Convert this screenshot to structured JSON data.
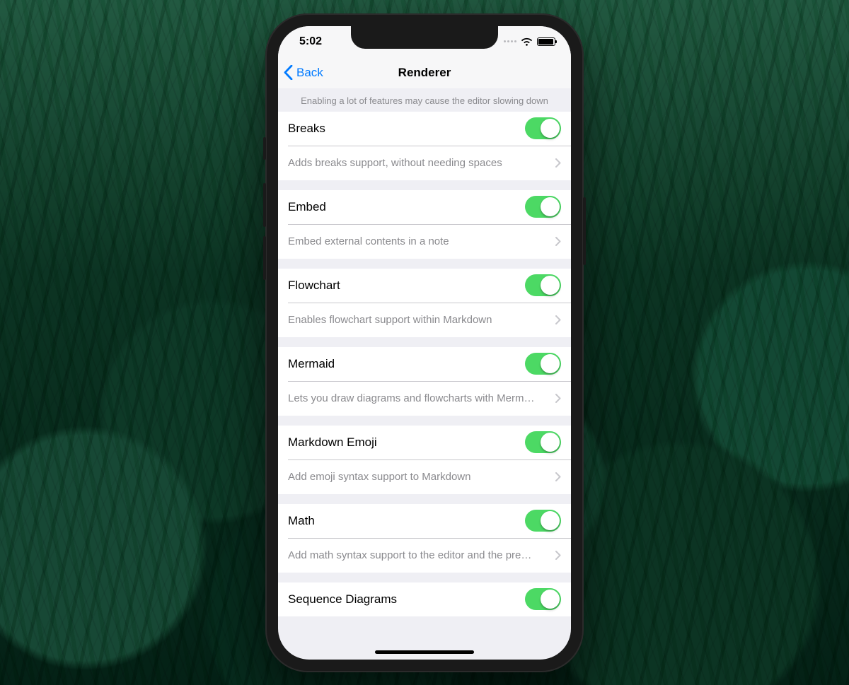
{
  "status": {
    "time": "5:02"
  },
  "nav": {
    "back": "Back",
    "title": "Renderer"
  },
  "hint": "Enabling a lot of features may cause the editor slowing down",
  "colors": {
    "accent": "#007aff",
    "switch_on": "#4cd964"
  },
  "rows": [
    {
      "label": "Breaks",
      "on": true,
      "desc": "Adds breaks support, without needing spaces"
    },
    {
      "label": "Embed",
      "on": true,
      "desc": "Embed external contents in a note"
    },
    {
      "label": "Flowchart",
      "on": true,
      "desc": "Enables flowchart support within Markdown"
    },
    {
      "label": "Mermaid",
      "on": true,
      "desc": "Lets you draw diagrams and flowcharts with Merm…"
    },
    {
      "label": "Markdown Emoji",
      "on": true,
      "desc": "Add emoji syntax support to Markdown"
    },
    {
      "label": "Math",
      "on": true,
      "desc": "Add math syntax support to the editor and the pre…"
    },
    {
      "label": "Sequence Diagrams",
      "on": true,
      "desc": ""
    }
  ]
}
